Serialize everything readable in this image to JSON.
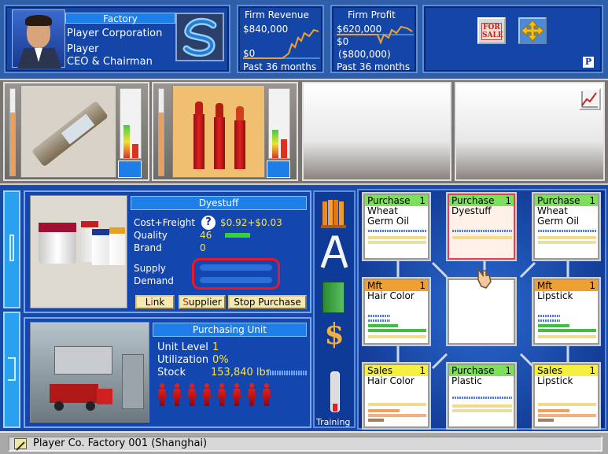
{
  "header": {
    "firm_type": "Factory",
    "corporation": "Player Corporation",
    "player_name": "Player",
    "player_title": "CEO & Chairman",
    "revenue": {
      "title": "Firm Revenue",
      "top_value": "$840,000",
      "bottom_value": "$0",
      "period": "Past 36 months"
    },
    "profit": {
      "title": "Firm Profit",
      "top_value": "$620,000",
      "mid_value": "$0",
      "bottom_value": "($800,000)",
      "period": "Past 36 months"
    },
    "for_sale_label": "FOR SALE",
    "p_badge": "P"
  },
  "detail": {
    "product_name": "Dyestuff",
    "cost_label": "Cost+Freight",
    "cost_value": "$0.92+$0.03",
    "quality_label": "Quality",
    "quality_value": "46",
    "brand_label": "Brand",
    "brand_value": "0",
    "supply_label": "Supply",
    "demand_label": "Demand",
    "help_icon": "?",
    "buttons": {
      "link": "Link",
      "supplier": "Supplier",
      "stop": "Stop Purchase"
    }
  },
  "unit": {
    "title": "Purchasing Unit",
    "level_label": "Unit Level",
    "level_value": "1",
    "util_label": "Utilization",
    "util_value": "0%",
    "stock_label": "Stock",
    "stock_value": "153,840 lbs"
  },
  "tools": {
    "training_label": "Training",
    "dollar": "$"
  },
  "grid": [
    {
      "type": "Purchase",
      "level": "1",
      "product": "Wheat Germ Oil",
      "color": "#7de05a"
    },
    {
      "type": "Purchase",
      "level": "1",
      "product": "Dyestuff",
      "color": "#7de05a"
    },
    {
      "type": "Purchase",
      "level": "1",
      "product": "Wheat Germ Oil",
      "color": "#7de05a"
    },
    {
      "type": "Mft",
      "level": "1",
      "product": "Hair Color",
      "color": "#f0a030"
    },
    {
      "type": "",
      "level": "",
      "product": "",
      "color": ""
    },
    {
      "type": "Mft",
      "level": "1",
      "product": "Lipstick",
      "color": "#f0a030"
    },
    {
      "type": "Sales",
      "level": "1",
      "product": "Hair Color",
      "color": "#f5ef40"
    },
    {
      "type": "Purchase",
      "level": "1",
      "product": "Plastic",
      "color": "#7de05a"
    },
    {
      "type": "Sales",
      "level": "1",
      "product": "Lipstick",
      "color": "#f5ef40"
    }
  ],
  "status_bar": {
    "text": "Player Co. Factory 001 (Shanghai)"
  }
}
